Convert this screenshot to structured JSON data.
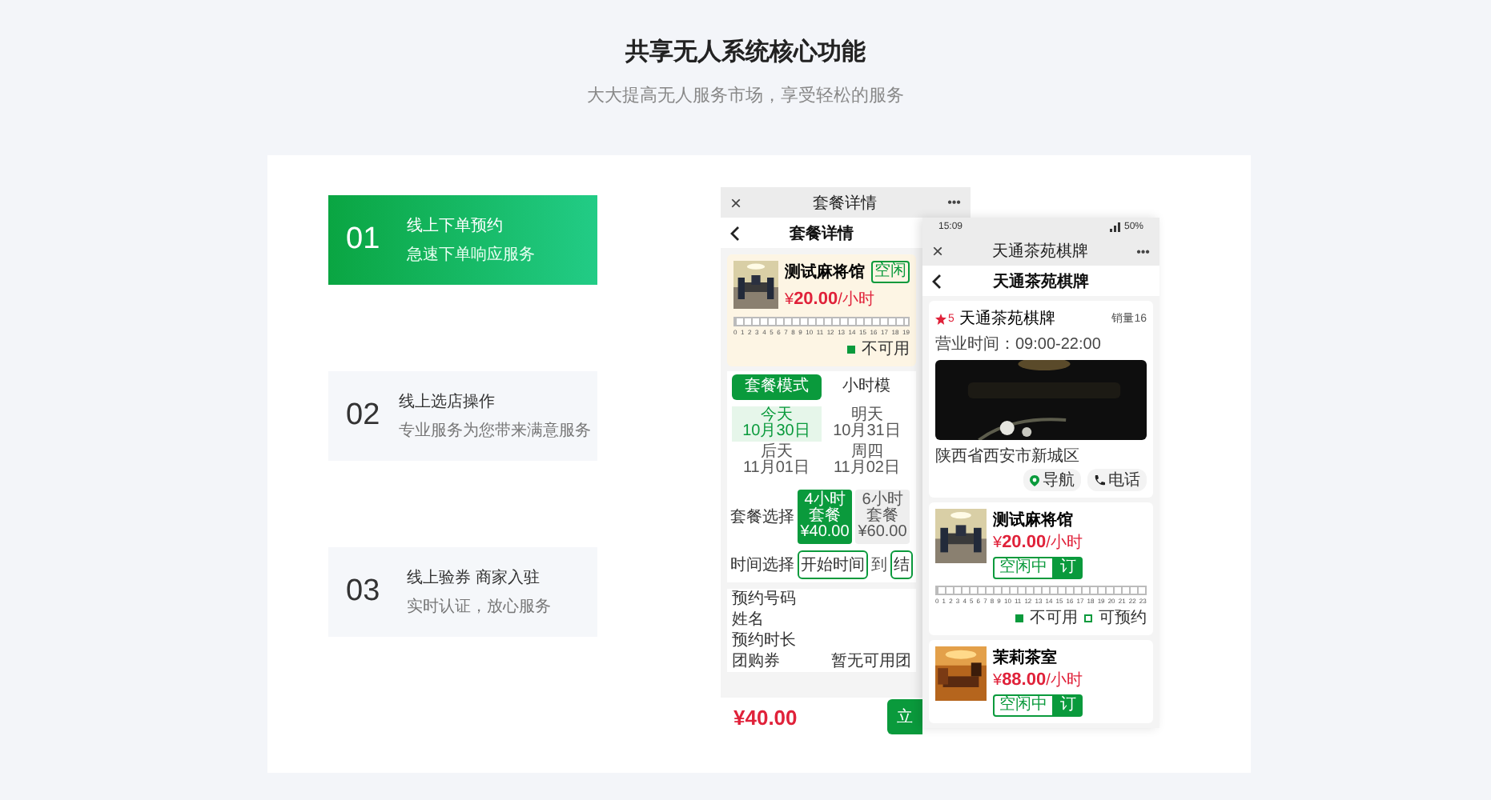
{
  "header": {
    "title": "共享无人系统核心功能",
    "subtitle": "大大提高无人服务市场，享受轻松的服务"
  },
  "features": [
    {
      "number": "01",
      "title": "线上下单预约",
      "description": "急速下单响应服务",
      "selected": true
    },
    {
      "number": "02",
      "title": "线上选店操作",
      "description": "专业服务为您带来满意服务",
      "selected": false
    },
    {
      "number": "03",
      "title": "线上验券 商家入驻",
      "description": "实时认证，放心服务",
      "selected": false
    }
  ],
  "detail_phone": {
    "window_title": "套餐详情",
    "close": "×",
    "more": "•••",
    "nav_title": "套餐详情",
    "room": {
      "name": "测试麻将馆",
      "price": "20.00",
      "unit": "/小时",
      "currency": "¥",
      "status_button": "空闲",
      "hours": [
        "0",
        "1",
        "2",
        "3",
        "4",
        "5",
        "6",
        "7",
        "8",
        "9",
        "10",
        "11",
        "12",
        "13",
        "14",
        "15",
        "16",
        "17",
        "18",
        "19"
      ],
      "legend": "不可用"
    },
    "tabs": [
      {
        "label": "套餐模式",
        "selected": true
      },
      {
        "label": "小时模",
        "selected": false
      }
    ],
    "dates": [
      {
        "day": "今天",
        "date": "10月30日",
        "selected": true
      },
      {
        "day": "明天",
        "date": "10月31日",
        "selected": false
      },
      {
        "day": "后天",
        "date": "11月01日",
        "selected": false
      },
      {
        "day": "周四",
        "date": "11月02日",
        "selected": false
      }
    ],
    "package_label": "套餐选择",
    "packages": [
      {
        "name": "4小时套餐",
        "price": "¥40.00",
        "selected": true
      },
      {
        "name": "6小时套餐",
        "price": "¥60.00",
        "selected": false
      }
    ],
    "time_label": "时间选择",
    "start_time": "开始时间",
    "to": "到",
    "end_time": "结",
    "form": [
      {
        "label": "预约号码"
      },
      {
        "label": "姓名"
      },
      {
        "label": "预约时长"
      },
      {
        "label": "团购券",
        "value": "暂无可用团"
      }
    ],
    "total": "¥40.00",
    "submit": "立"
  },
  "shop_phone": {
    "time": "15:09",
    "battery": "50%",
    "window_title": "天通茶苑棋牌",
    "close": "×",
    "more": "•••",
    "nav_title": "天通茶苑棋牌",
    "shop": {
      "rating": "5",
      "name": "天通茶苑棋牌",
      "sales": "销量16",
      "hours": "营业时间：09:00-22:00",
      "address": "陕西省西安市新城区",
      "navigate": "导航",
      "call": "电话"
    },
    "rooms": [
      {
        "name": "测试麻将馆",
        "currency": "¥",
        "price": "20.00",
        "unit": "/小时",
        "status": "空闲中",
        "book": "订",
        "hours": [
          "0",
          "1",
          "2",
          "3",
          "4",
          "5",
          "6",
          "7",
          "8",
          "9",
          "10",
          "11",
          "12",
          "13",
          "14",
          "15",
          "16",
          "17",
          "18",
          "19",
          "20",
          "21",
          "22",
          "23"
        ],
        "legend": [
          {
            "label": "不可用",
            "kind": "filled"
          },
          {
            "label": "可预约",
            "kind": "empty"
          }
        ]
      },
      {
        "name": "茉莉茶室",
        "currency": "¥",
        "price": "88.00",
        "unit": "/小时",
        "status": "空闲中",
        "book": "订"
      }
    ]
  }
}
